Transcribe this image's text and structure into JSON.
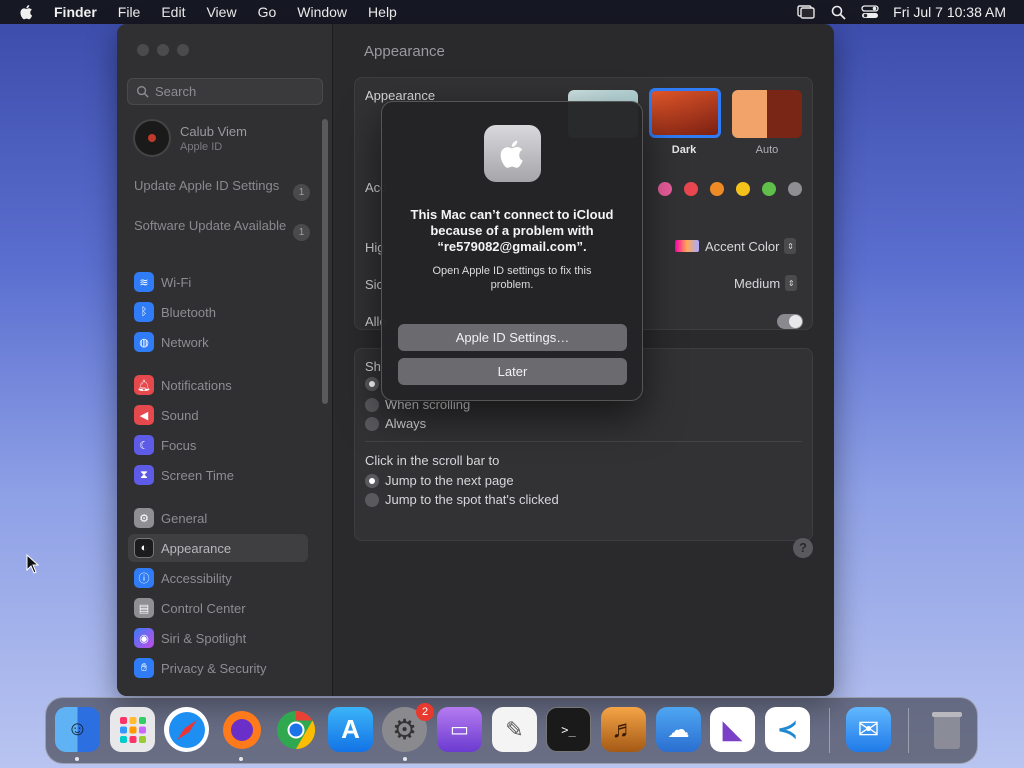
{
  "menubar": {
    "app_name": "Finder",
    "items": [
      "File",
      "Edit",
      "View",
      "Go",
      "Window",
      "Help"
    ],
    "clock": "Fri Jul 7  10:38 AM"
  },
  "window": {
    "search_placeholder": "Search",
    "account": {
      "name": "Calub Viem",
      "subtitle": "Apple ID"
    },
    "updates": [
      {
        "label": "Update Apple ID Settings",
        "badge": "1"
      },
      {
        "label": "Software Update Available",
        "badge": "1"
      }
    ],
    "sidebar_items": [
      {
        "label": "Wi-Fi",
        "icon": "wifi-icon",
        "color": "#2f7cf6"
      },
      {
        "label": "Bluetooth",
        "icon": "bluetooth-icon",
        "color": "#2f7cf6"
      },
      {
        "label": "Network",
        "icon": "globe-icon",
        "color": "#2f7cf6"
      },
      {
        "label": "Notifications",
        "icon": "bell-icon",
        "color": "#e5484d"
      },
      {
        "label": "Sound",
        "icon": "speaker-icon",
        "color": "#e5484d"
      },
      {
        "label": "Focus",
        "icon": "moon-icon",
        "color": "#5e5ce6"
      },
      {
        "label": "Screen Time",
        "icon": "hourglass-icon",
        "color": "#5e5ce6"
      },
      {
        "label": "General",
        "icon": "gear-icon",
        "color": "#8e8e93"
      },
      {
        "label": "Appearance",
        "icon": "appearance-icon",
        "color": "#1c1c1e"
      },
      {
        "label": "Accessibility",
        "icon": "accessibility-icon",
        "color": "#2f7cf6"
      },
      {
        "label": "Control Center",
        "icon": "control-center-icon",
        "color": "#8e8e93"
      },
      {
        "label": "Siri & Spotlight",
        "icon": "siri-icon",
        "color": "#a94be6"
      },
      {
        "label": "Privacy & Security",
        "icon": "hand-icon",
        "color": "#2f7cf6"
      }
    ],
    "content": {
      "title": "Appearance",
      "appearance_label": "Appearance",
      "options": [
        {
          "label": ""
        },
        {
          "label": "Dark"
        },
        {
          "label": "Auto"
        }
      ],
      "accent_label_partial": "Acc",
      "highlight_label_partial": "Hig",
      "highlight_value": "Accent Color",
      "sidebar_size_label_partial": "Sic",
      "sidebar_size_value": "Medium",
      "allow_label_partial": "Allo",
      "show_scroll_partial": "Sh",
      "scroll_options": [
        "When scrolling",
        "Always"
      ],
      "click_label": "Click in the scroll bar to",
      "click_options": [
        "Jump to the next page",
        "Jump to the spot that's clicked"
      ],
      "help": "?"
    }
  },
  "dialog": {
    "title": "This Mac can’t connect to iCloud because of a problem with “re579082@gmail.com”.",
    "message": "Open Apple ID settings to fix this problem.",
    "primary_button": "Apple ID Settings…",
    "secondary_button": "Later"
  },
  "dock": {
    "badge_settings": "2",
    "apps": [
      "finder-icon",
      "launchpad-icon",
      "safari-icon",
      "firefox-icon",
      "chrome-icon",
      "app-store-icon",
      "system-settings-icon",
      "podcasts-capture-icon",
      "textedit-icon",
      "terminal-icon",
      "garageband-icon",
      "weather-icon",
      "visual-studio-icon",
      "vscode-icon",
      "mail-icon",
      "trash-icon"
    ]
  },
  "colors": {
    "accent_dots": [
      "#e85d9c",
      "#e8474f",
      "#f08a24",
      "#f5c21b",
      "#5fbf4a",
      "#8e8e93"
    ]
  }
}
